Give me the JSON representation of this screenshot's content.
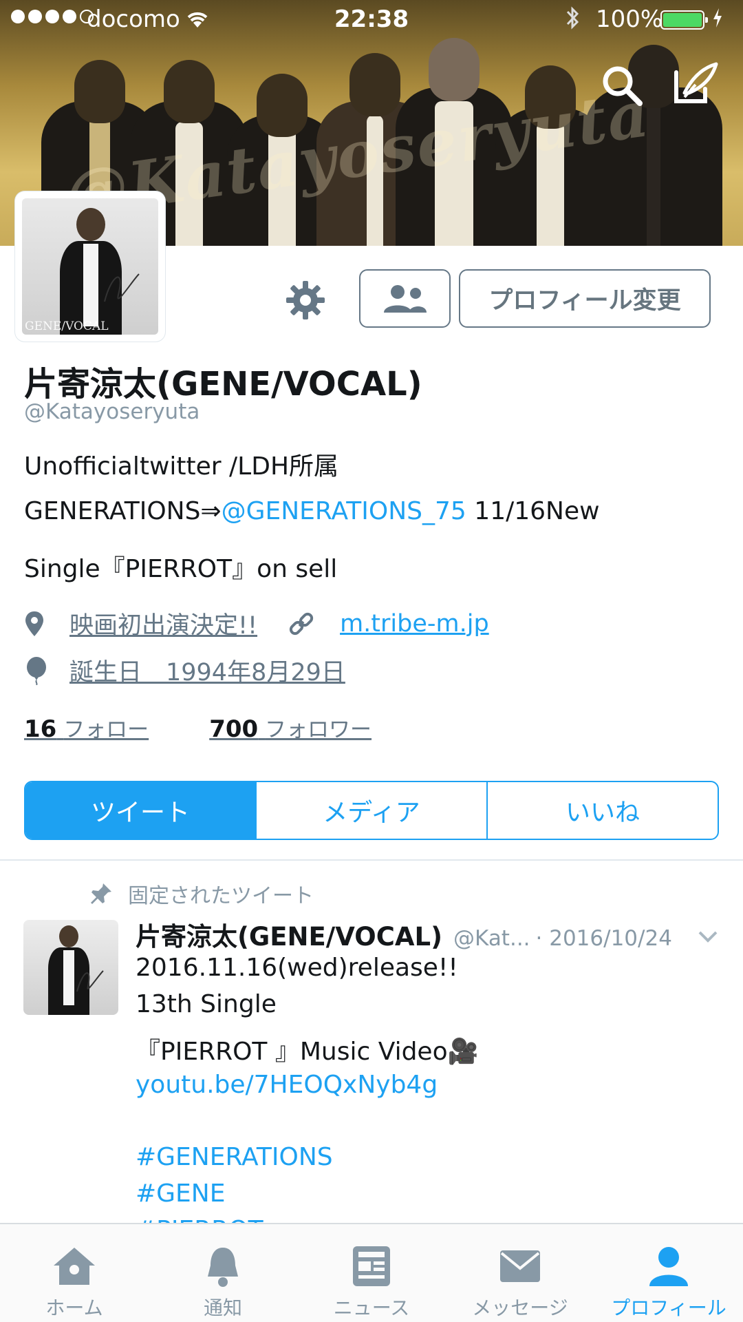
{
  "status_bar": {
    "carrier": "docomo",
    "time": "22:38",
    "battery": "100%"
  },
  "header": {
    "watermark": "@Katayoseryuta"
  },
  "avatar": {
    "caption": "GENE/VOCAL"
  },
  "actions": {
    "edit_profile_label": "プロフィール変更"
  },
  "profile": {
    "display_name": "片寄涼太(GENE/VOCAL)",
    "handle": "@Katayoseryuta",
    "bio_line1": "Unofficialtwitter /LDH所属",
    "bio_line2_prefix": "GENERATIONS⇒",
    "bio_line2_mention": "@GENERATIONS_75",
    "bio_line2_suffix": " 11/16New",
    "bio_line3": "Single『PIERROT』on sell",
    "location": "映画初出演決定!!",
    "website": "m.tribe-m.jp",
    "birthday": "誕生日　1994年8月29日",
    "following_count": "16",
    "following_label": "フォロー",
    "followers_count": "700",
    "followers_label": "フォロワー"
  },
  "tabs": [
    {
      "label": "ツイート",
      "active": true
    },
    {
      "label": "メディア",
      "active": false
    },
    {
      "label": "いいね",
      "active": false
    }
  ],
  "pinned_tweet": {
    "pinned_label": "固定されたツイート",
    "name": "片寄涼太(GENE/VOCAL)",
    "handle": "@Kat...",
    "date": "· 2016/10/24",
    "lines": [
      "2016.11.16(wed)release!!",
      "13th Single",
      "『PIERROT 』Music Video🎥",
      "youtu.be/7HEOQxNyb4g",
      "#GENERATIONS",
      "#GENE",
      "#PIERROT"
    ]
  },
  "tab_bar": {
    "items": [
      {
        "label": "ホーム",
        "icon": "home-icon"
      },
      {
        "label": "通知",
        "icon": "bell-icon"
      },
      {
        "label": "ニュース",
        "icon": "news-icon"
      },
      {
        "label": "メッセージ",
        "icon": "envelope-icon"
      },
      {
        "label": "プロフィール",
        "icon": "person-icon"
      }
    ],
    "active_index": 4
  },
  "colors": {
    "accent": "#1da1f2",
    "text": "#14171a",
    "muted": "#657786",
    "battery": "#4cd964"
  }
}
